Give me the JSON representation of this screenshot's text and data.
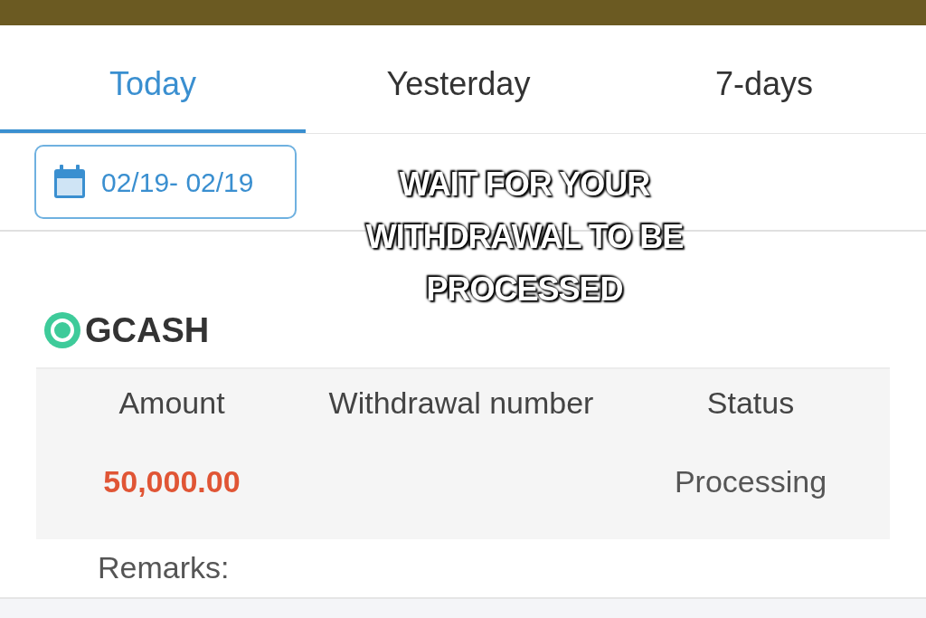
{
  "tabs": [
    {
      "label": "Today",
      "selected": true
    },
    {
      "label": "Yesterday",
      "selected": false
    },
    {
      "label": "7-days",
      "selected": false
    }
  ],
  "date_range": "02/19- 02/19",
  "caption": [
    "WAIT FOR YOUR",
    "WITHDRAWAL TO BE",
    "PROCESSED"
  ],
  "method": "GCASH",
  "table": {
    "columns": [
      "Amount",
      "Withdrawal number",
      "Status"
    ],
    "rows": [
      {
        "amount": "50,000.00",
        "withdrawal_number": "",
        "status": "Processing"
      }
    ]
  },
  "remarks": "Remarks:"
}
